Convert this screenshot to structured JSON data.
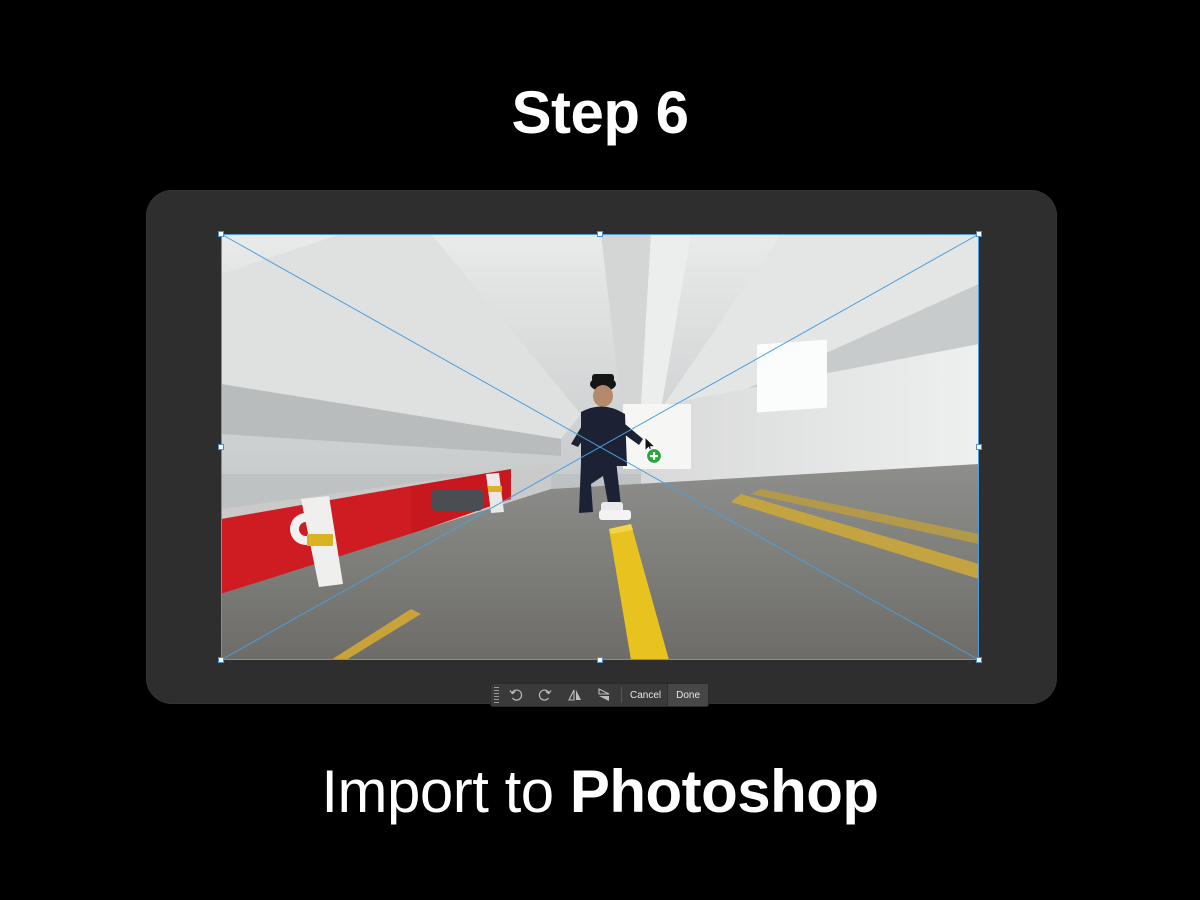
{
  "header": {
    "title": "Step 6"
  },
  "caption": {
    "prefix": "Import to",
    "emphasis": "Photoshop"
  },
  "toolbar": {
    "icons": [
      "grip-icon",
      "rotate-left-icon",
      "rotate-right-icon",
      "flip-horizontal-icon",
      "flip-vertical-icon"
    ],
    "cancel_label": "Cancel",
    "done_label": "Done"
  },
  "canvas": {
    "content": "photo of a person on a yellow curb inside a parking garage",
    "cursor": "plus-cursor-icon"
  },
  "colors": {
    "background": "#000000",
    "frame": "#2e2e2e",
    "guide_line": "#4a9ee0",
    "curb_yellow": "#e8c320",
    "wall_red": "#d11a21",
    "cursor_green": "#27a83a"
  }
}
